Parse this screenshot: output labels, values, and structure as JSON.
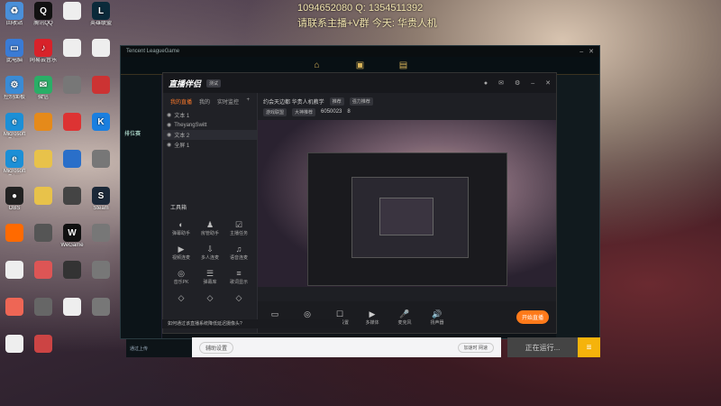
{
  "overlay": {
    "line1": "1094652080  Q:  1354511392",
    "line2": "请联系主播+V群 今天:  华贵人机"
  },
  "desktop_icons": [
    {
      "label": "回收站",
      "icon": "recycle-bin-icon",
      "color": "#4a90d9",
      "glyph": "♻"
    },
    {
      "label": "腾讯QQ",
      "icon": "qq-icon",
      "color": "#111",
      "glyph": "Q"
    },
    {
      "label": "",
      "icon": "file-icon",
      "color": "#eee",
      "glyph": ""
    },
    {
      "label": "英雄联盟",
      "icon": "lol-icon",
      "color": "#0b2a3a",
      "glyph": "L"
    },
    {
      "label": "此电脑",
      "icon": "computer-icon",
      "color": "#3a7bd5",
      "glyph": "▭"
    },
    {
      "label": "网易云音乐",
      "icon": "netease-music-icon",
      "color": "#d8222a",
      "glyph": "♪"
    },
    {
      "label": "",
      "icon": "file-icon",
      "color": "#eee",
      "glyph": ""
    },
    {
      "label": "",
      "icon": "file-icon",
      "color": "#eee",
      "glyph": ""
    },
    {
      "label": "控制面板",
      "icon": "control-panel-icon",
      "color": "#3a8bd5",
      "glyph": "⚙"
    },
    {
      "label": "微信",
      "icon": "wechat-icon",
      "color": "#2aae67",
      "glyph": "✉"
    },
    {
      "label": "",
      "icon": "app-icon",
      "color": "#777",
      "glyph": ""
    },
    {
      "label": "",
      "icon": "app-icon",
      "color": "#c33",
      "glyph": ""
    },
    {
      "label": "Microsoft Edge",
      "icon": "edge-icon",
      "color": "#1c8fd6",
      "glyph": "e"
    },
    {
      "label": "",
      "icon": "app-icon",
      "color": "#e58a1a",
      "glyph": ""
    },
    {
      "label": "",
      "icon": "app-icon",
      "color": "#d33",
      "glyph": ""
    },
    {
      "label": "",
      "icon": "kugou-icon",
      "color": "#1a7fe0",
      "glyph": "K"
    },
    {
      "label": "Microsoft Edge",
      "icon": "edge-icon",
      "color": "#1c8fd6",
      "glyph": "e"
    },
    {
      "label": "",
      "icon": "folder-icon",
      "color": "#e8c24a",
      "glyph": ""
    },
    {
      "label": "",
      "icon": "app-icon",
      "color": "#2a6fc9",
      "glyph": ""
    },
    {
      "label": "",
      "icon": "app-icon",
      "color": "#777",
      "glyph": ""
    },
    {
      "label": "OBS",
      "icon": "obs-icon",
      "color": "#222",
      "glyph": "●"
    },
    {
      "label": "",
      "icon": "folder-icon",
      "color": "#e8c24a",
      "glyph": ""
    },
    {
      "label": "",
      "icon": "app-icon",
      "color": "#444",
      "glyph": ""
    },
    {
      "label": "Steam",
      "icon": "steam-icon",
      "color": "#1b2838",
      "glyph": "S"
    },
    {
      "label": "",
      "icon": "app-icon",
      "color": "#ff6a00",
      "glyph": ""
    },
    {
      "label": "",
      "icon": "app-icon",
      "color": "#555",
      "glyph": ""
    },
    {
      "label": "WeGame",
      "icon": "wegame-icon",
      "color": "#111",
      "glyph": "W"
    },
    {
      "label": "",
      "icon": "app-icon",
      "color": "#777",
      "glyph": ""
    },
    {
      "label": "",
      "icon": "file-icon",
      "color": "#eee",
      "glyph": ""
    },
    {
      "label": "",
      "icon": "app-icon",
      "color": "#d55",
      "glyph": ""
    },
    {
      "label": "",
      "icon": "app-icon",
      "color": "#333",
      "glyph": ""
    },
    {
      "label": "",
      "icon": "app-icon",
      "color": "#777",
      "glyph": ""
    },
    {
      "label": "",
      "icon": "app-icon",
      "color": "#e65",
      "glyph": ""
    },
    {
      "label": "",
      "icon": "app-icon",
      "color": "#666",
      "glyph": ""
    },
    {
      "label": "",
      "icon": "file-icon",
      "color": "#eee",
      "glyph": ""
    },
    {
      "label": "",
      "icon": "app-icon",
      "color": "#777",
      "glyph": ""
    },
    {
      "label": "",
      "icon": "file-icon",
      "color": "#eee",
      "glyph": ""
    },
    {
      "label": "",
      "icon": "app-icon",
      "color": "#c44",
      "glyph": ""
    }
  ],
  "lol": {
    "title": "Tencent LeagueGame",
    "side_label": "排位赛",
    "bottom_label": "通过上传"
  },
  "live": {
    "logo": "直播伴侣",
    "version": "测试",
    "tabs": [
      "我的直播",
      "我的",
      "实时监控"
    ],
    "scenes": [
      "文本 1",
      "TheyangSwitt",
      "文本 2",
      "全屏 1"
    ],
    "tools_title": "工具箱",
    "tools": [
      "弹幕助手",
      "房管助手",
      "主播任务",
      "视频连麦",
      "多人连麦",
      "语音连麦",
      "音乐PK",
      "弹幕库",
      "歌词显示",
      "",
      "",
      ""
    ],
    "info_title": "约会天边都 华贵人机教学",
    "info_tag": "推荐",
    "info_tag2": "强力推荐",
    "info_cat": "游戏联盟",
    "info_mode": "大神推荐",
    "info_count": "6050023",
    "info_num": "8",
    "bottom_tools": [
      "直播屏幕",
      "摄像头",
      "全局设置",
      "多媒体",
      "麦克风",
      "扬声器"
    ],
    "start_label": "开始直播",
    "notice": "如何通过该直播系统降低延迟摄像头?"
  },
  "toolbar": {
    "settings_label": "辅助设置",
    "net_label": "加速时 网速",
    "status_label": "正在运行...",
    "menu_label": "≡"
  }
}
